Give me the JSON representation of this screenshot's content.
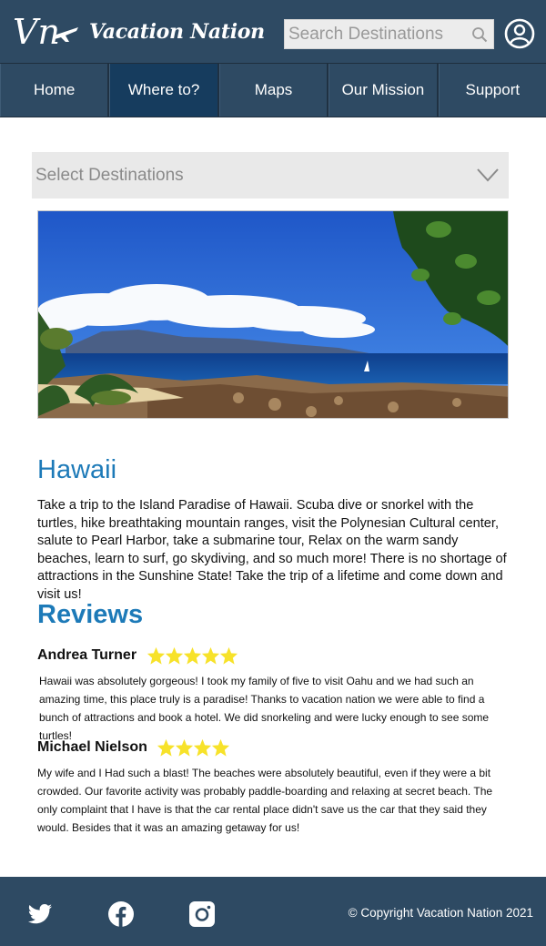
{
  "header": {
    "logo_text": "Vn",
    "brand": "Vacation Nation",
    "search_placeholder": "Search Destinations"
  },
  "nav": {
    "items": [
      {
        "label": "Home"
      },
      {
        "label": "Where to?"
      },
      {
        "label": "Maps"
      },
      {
        "label": "Our Mission"
      },
      {
        "label": "Support"
      }
    ],
    "active_index": 1
  },
  "dropdown": {
    "label": "Select Destinations"
  },
  "destination": {
    "title": "Hawaii",
    "description": "Take a trip to the Island Paradise of Hawaii. Scuba dive or snorkel with the turtles, hike breathtaking mountain ranges, visit the Polynesian Cultural center, salute to Pearl Harbor, take a submarine tour, Relax on the warm sandy beaches, learn to surf, go skydiving, and so much more! There is no shortage of attractions in the Sunshine State! Take the trip of a lifetime and come down and visit us!"
  },
  "reviews": {
    "title": "Reviews",
    "items": [
      {
        "name": "Andrea Turner",
        "rating": 5,
        "text": "Hawaii was absolutely gorgeous! I took my family of five to visit Oahu and we had such an amazing time, this place truly is a paradise! Thanks to vacation nation we were able to find a bunch of attractions and book a hotel. We did snorkeling and were lucky enough to see some turtles!"
      },
      {
        "name": "Michael Nielson",
        "rating": 4,
        "text": "My wife and I Had such a blast! The beaches were absolutely beautiful, even if they were a bit crowded. Our favorite activity was probably paddle-boarding and relaxing at secret beach. The only complaint that I have is that the car rental place didn't save us the car that they said they would. Besides that it was an amazing getaway for us!"
      }
    ]
  },
  "footer": {
    "social": [
      "twitter-icon",
      "facebook-icon",
      "instagram-icon"
    ],
    "copyright": "© Copyright Vacation Nation 2021"
  },
  "colors": {
    "header_bg": "#2e4a63",
    "nav_active_bg": "#163c5e",
    "heading_blue": "#1d7ab8",
    "star_yellow": "#f7e22a"
  }
}
